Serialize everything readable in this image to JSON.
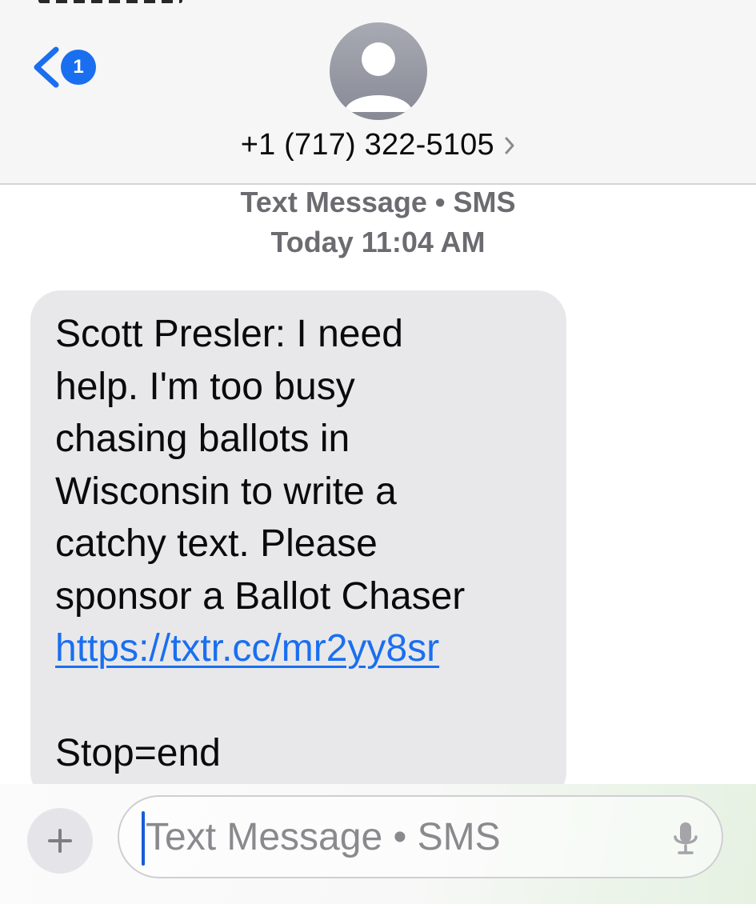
{
  "header": {
    "back_badge_count": "1",
    "contact_name": "+1 (717) 322-5105"
  },
  "thread": {
    "service_label": "Text Message • SMS",
    "timestamp": "Today 11:04 AM"
  },
  "message": {
    "lines": [
      "Scott Presler: I need",
      "help. I'm too busy",
      "chasing ballots in",
      "Wisconsin to write a",
      "catchy text. Please",
      "sponsor a Ballot Chaser"
    ],
    "link": "https://txtr.cc/mr2yy8sr",
    "footer": "Stop=end"
  },
  "composer": {
    "placeholder": "Text Message • SMS"
  },
  "colors": {
    "accent": "#1a6ff0",
    "bubble": "#e8e8eb",
    "header_bg": "#f6f6f6",
    "meta_text": "#6b6b70"
  },
  "icons": {
    "back": "chevron-left-icon",
    "avatar": "person-icon",
    "contact_details": "chevron-right-icon",
    "add": "plus-icon",
    "dictation": "microphone-icon"
  }
}
